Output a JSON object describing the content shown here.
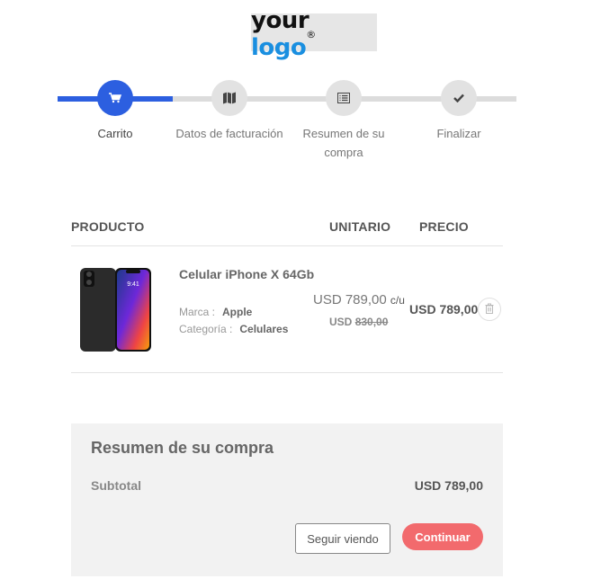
{
  "logo": {
    "word1": "your",
    "word2": "logo",
    "mark": "®"
  },
  "steps": [
    {
      "label": "Carrito",
      "icon": "cart-icon",
      "active": true
    },
    {
      "label": "Datos de facturación",
      "icon": "map-icon",
      "active": false
    },
    {
      "label": "Resumen de su compra",
      "icon": "list-icon",
      "active": false
    },
    {
      "label": "Finalizar",
      "icon": "check-icon",
      "active": false
    }
  ],
  "progress": {
    "completed_fraction": 0.25
  },
  "table": {
    "headers": {
      "product": "PRODUCTO",
      "unit": "UNITARIO",
      "price": "PRECIO"
    }
  },
  "item": {
    "name": "Celular iPhone X 64Gb",
    "brand_label": "Marca :",
    "brand": "Apple",
    "category_label": "Categoría :",
    "category": "Celulares",
    "unit_price": "USD 789,00",
    "unit_suffix": "c/u",
    "old_currency": "USD",
    "old_price": "830,00",
    "price": "USD 789,00",
    "phone_time": "9:41"
  },
  "summary": {
    "title": "Resumen de su compra",
    "subtotal_label": "Subtotal",
    "subtotal_value": "USD 789,00",
    "secondary_button": "Seguir viendo",
    "primary_button": "Continuar"
  },
  "colors": {
    "accent": "#2c5fe0",
    "primary_button": "#f26a6d",
    "inactive_step": "#e2e2e2"
  }
}
